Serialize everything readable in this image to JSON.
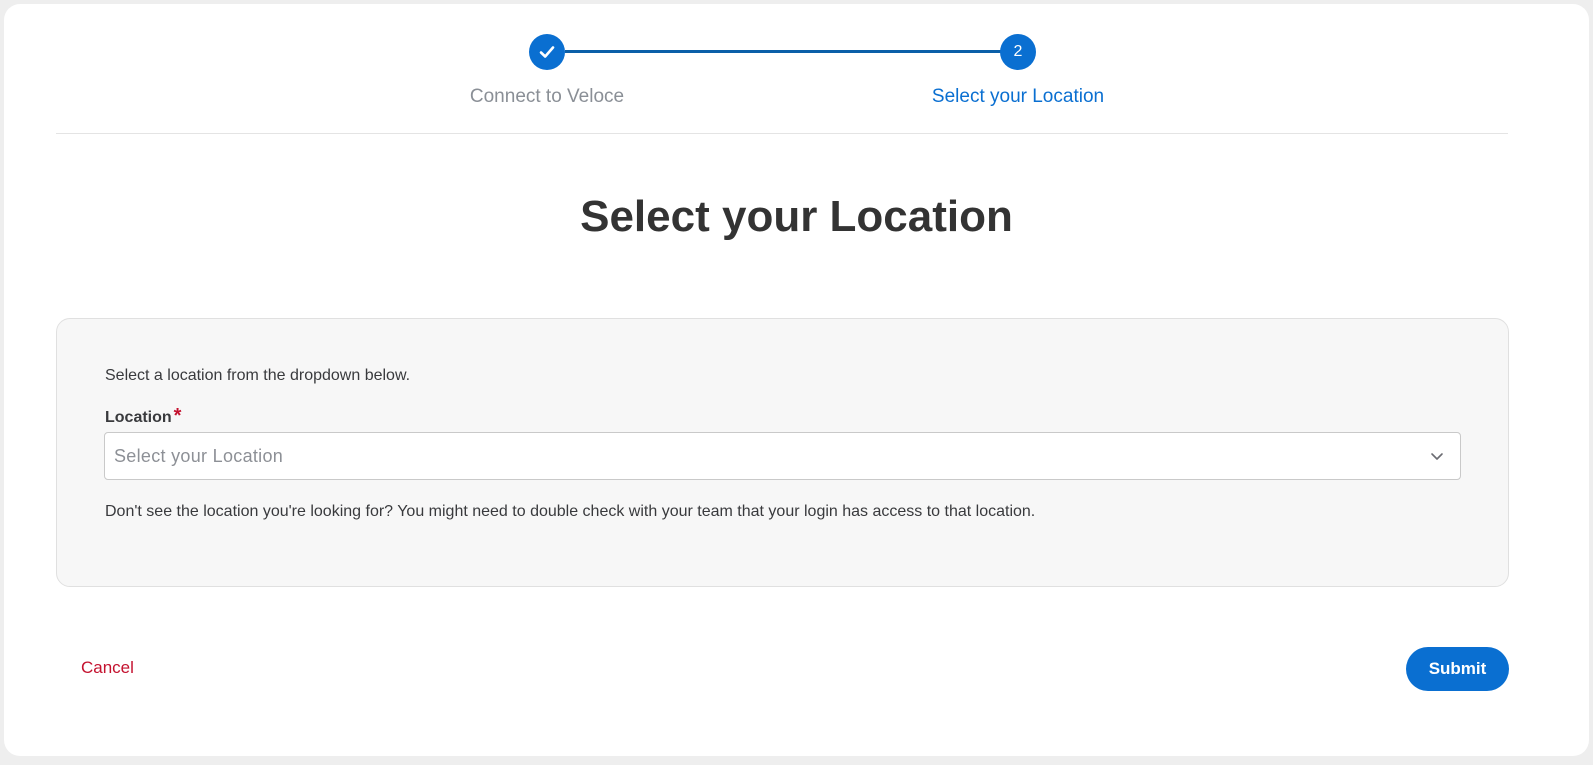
{
  "stepper": {
    "steps": [
      {
        "label": "Connect to Veloce",
        "status": "complete",
        "icon": "checkmark-icon"
      },
      {
        "label": "Select your Location",
        "status": "active",
        "number": "2"
      }
    ]
  },
  "main": {
    "title": "Select your Location",
    "panel": {
      "instructions": "Select a location from the dropdown below.",
      "field_label": "Location",
      "required_marker": "*",
      "select_placeholder": "Select your Location",
      "help_text": "Don't see the location you're looking for? You might need to double check with your team that your login has access to that location."
    }
  },
  "footer": {
    "cancel_label": "Cancel",
    "submit_label": "Submit"
  },
  "colors": {
    "accent": "#0a6fd1",
    "cancel": "#c4122f",
    "required": "#c4122f"
  }
}
